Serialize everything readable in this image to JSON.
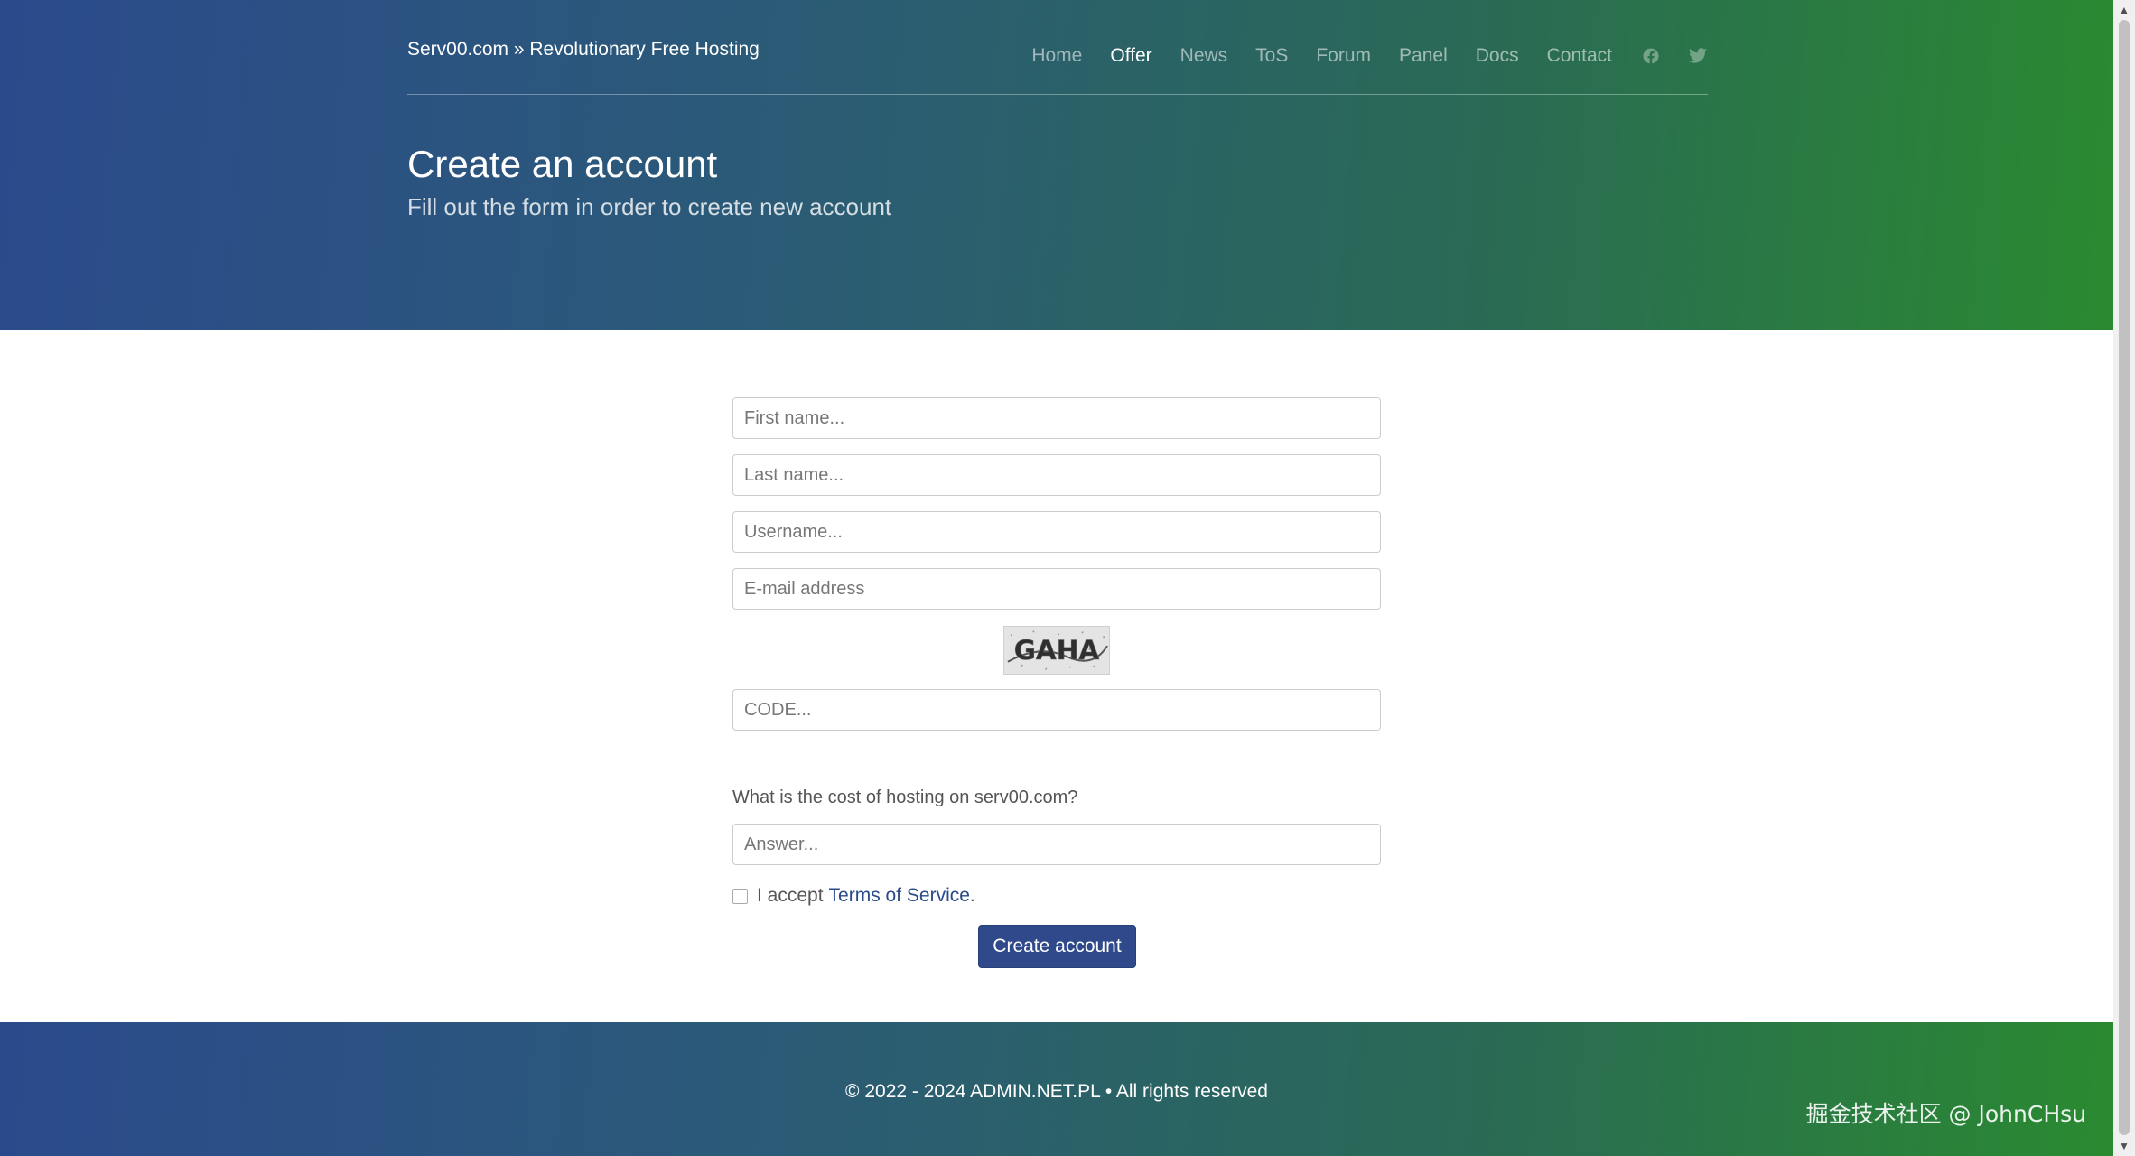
{
  "header": {
    "brand": "Serv00.com » Revolutionary Free Hosting",
    "nav": [
      {
        "label": "Home",
        "active": false
      },
      {
        "label": "Offer",
        "active": true
      },
      {
        "label": "News",
        "active": false
      },
      {
        "label": "ToS",
        "active": false
      },
      {
        "label": "Forum",
        "active": false
      },
      {
        "label": "Panel",
        "active": false
      },
      {
        "label": "Docs",
        "active": false
      },
      {
        "label": "Contact",
        "active": false
      }
    ],
    "social": [
      "facebook-icon",
      "twitter-icon"
    ],
    "title": "Create an account",
    "subtitle": "Fill out the form in order to create new account"
  },
  "form": {
    "first_name": {
      "placeholder": "First name...",
      "value": ""
    },
    "last_name": {
      "placeholder": "Last name...",
      "value": ""
    },
    "username": {
      "placeholder": "Username...",
      "value": ""
    },
    "email": {
      "placeholder": "E-mail address",
      "value": ""
    },
    "captcha_text": "GAHA",
    "code": {
      "placeholder": "CODE...",
      "value": ""
    },
    "question": "What is the cost of hosting on serv00.com?",
    "answer": {
      "placeholder": "Answer...",
      "value": ""
    },
    "tos_prefix": "I accept",
    "tos_link": "Terms of Service",
    "tos_suffix": ".",
    "tos_checked": false,
    "submit_label": "Create account"
  },
  "footer": {
    "copyright": "© 2022 - 2024 ADMIN.NET.PL • All rights reserved",
    "watermark": "掘金技术社区 @ JohnCHsu"
  },
  "colors": {
    "gradient_start": "#2b4a8c",
    "gradient_end": "#2a8a30",
    "button": "#30498a",
    "link": "#2a4a8a"
  }
}
